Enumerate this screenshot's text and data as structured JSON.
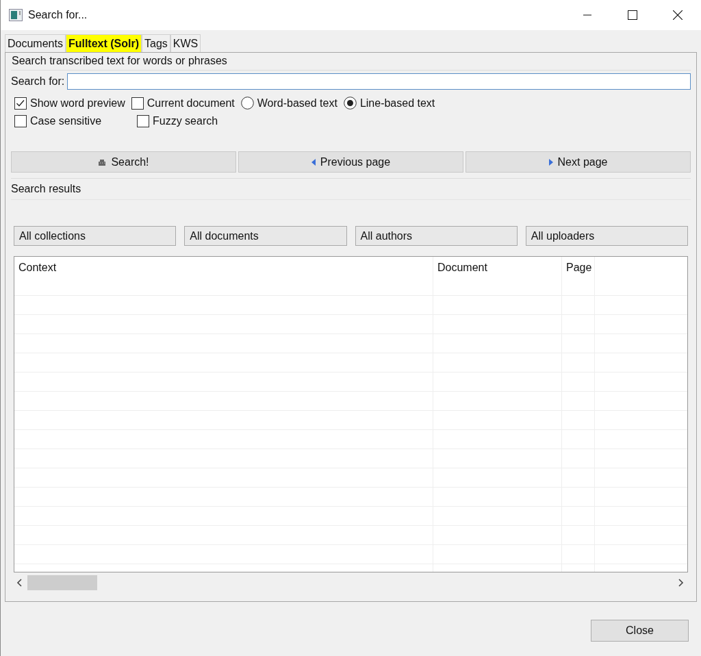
{
  "window": {
    "title": "Search for..."
  },
  "tabs": [
    {
      "label": "Documents",
      "selected": false
    },
    {
      "label": "Fulltext (Solr)",
      "selected": true
    },
    {
      "label": "Tags",
      "selected": false
    },
    {
      "label": "KWS",
      "selected": false
    }
  ],
  "search_group": {
    "title": "Search transcribed text for words or phrases",
    "label": "Search for:"
  },
  "options": [
    {
      "kind": "checkbox",
      "label": "Show word preview",
      "checked": true
    },
    {
      "kind": "checkbox",
      "label": "Current document",
      "checked": false
    },
    {
      "kind": "radio",
      "label": "Word-based text",
      "selected": false
    },
    {
      "kind": "radio",
      "label": "Line-based text",
      "selected": true
    },
    {
      "kind": "checkbox",
      "label": "Case sensitive",
      "checked": false
    },
    {
      "kind": "checkbox",
      "label": "Fuzzy search",
      "checked": false
    }
  ],
  "buttons": [
    {
      "kind": "search",
      "label": "Search!"
    },
    {
      "kind": "previous",
      "label": "Previous page"
    },
    {
      "kind": "next",
      "label": "Next page"
    }
  ],
  "results": {
    "title": "Search results",
    "filters": [
      "All collections",
      "All documents",
      "All authors",
      "All uploaders"
    ],
    "columns": [
      "Context",
      "Document",
      "Page"
    ]
  },
  "footer": {
    "close": "Close"
  }
}
